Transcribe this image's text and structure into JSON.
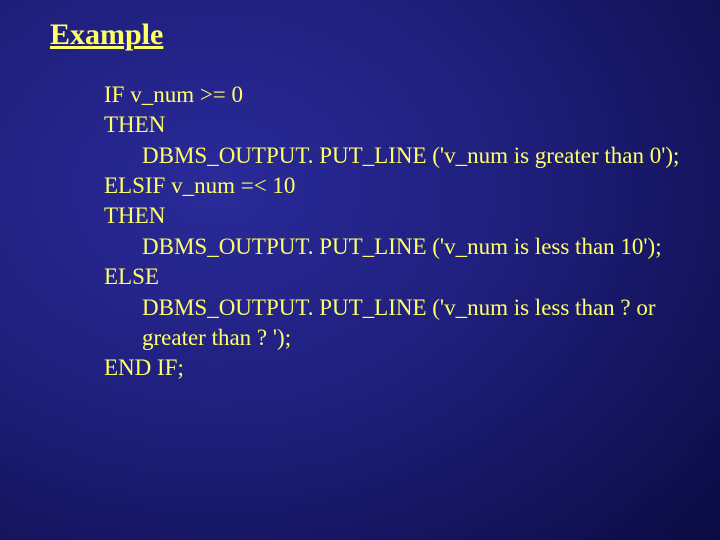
{
  "title": "Example",
  "code": {
    "l1": "IF v_num >= 0",
    "l2": "THEN",
    "l3": "DBMS_OUTPUT. PUT_LINE ('v_num is greater than 0');",
    "l4": "ELSIF v_num =< 10",
    "l5": "THEN",
    "l6": "DBMS_OUTPUT. PUT_LINE ('v_num is less than 10');",
    "l7": "ELSE",
    "l8": "DBMS_OUTPUT. PUT_LINE ('v_num is less than ? or",
    "l9": "greater than ? ');",
    "l10": "END IF;"
  }
}
